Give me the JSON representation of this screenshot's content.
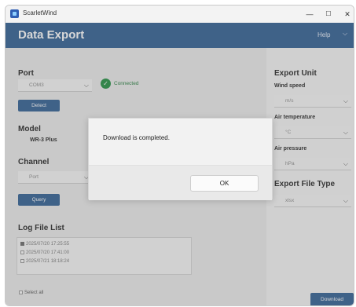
{
  "window": {
    "title": "ScarletWind",
    "minimize_glyph": "—",
    "maximize_glyph": "☐",
    "close_glyph": "✕"
  },
  "header": {
    "title": "Data Export",
    "help": "Help",
    "chevron": "⌵"
  },
  "left": {
    "port": {
      "label": "Port",
      "value": "COM3",
      "status": "Connected",
      "detect": "Detect"
    },
    "model": {
      "label": "Model",
      "value": "WR-3 Plus"
    },
    "channel": {
      "label": "Channel",
      "value": "Port",
      "query": "Query"
    },
    "log": {
      "label": "Log File List",
      "files": [
        {
          "date": "2025/07/20 17:25:55",
          "checked": true
        },
        {
          "date": "2025/07/20 17:41:00",
          "checked": false
        },
        {
          "date": "2025/07/21 18:18:24",
          "checked": false
        }
      ],
      "select_all": "Select all"
    }
  },
  "right": {
    "export_unit": "Export Unit",
    "wind_speed": {
      "label": "Wind speed",
      "value": "m/s"
    },
    "air_temperature": {
      "label": "Air temperature",
      "value": "°C"
    },
    "air_pressure": {
      "label": "Air pressure",
      "value": "hPa"
    },
    "file_type": {
      "label": "Export File Type",
      "value": "xlsx"
    },
    "download": "Download"
  },
  "dialog": {
    "message": "Download is completed.",
    "ok": "OK"
  },
  "colors": {
    "header": "#2d5d92",
    "button": "#2d5d92",
    "connected": "#1e8e3e"
  },
  "icons": {
    "connected": "✓",
    "dropdown": "⌵"
  }
}
